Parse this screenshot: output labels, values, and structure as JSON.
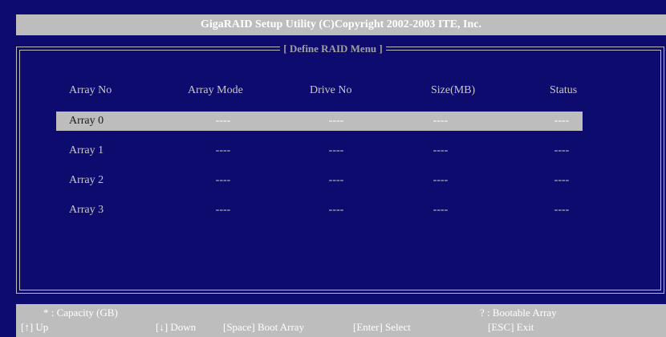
{
  "title": "GigaRAID Setup Utility (C)Copyright 2002-2003 ITE, Inc.",
  "menu_title": "[  Define RAID Menu  ]",
  "columns": [
    "Array No",
    "Array Mode",
    "Drive No",
    "Size(MB)",
    "Status"
  ],
  "rows": [
    {
      "no": "Array 0",
      "mode": "----",
      "drive": "----",
      "size": "----",
      "status": "----",
      "selected": true
    },
    {
      "no": "Array 1",
      "mode": "----",
      "drive": "----",
      "size": "----",
      "status": "----",
      "selected": false
    },
    {
      "no": "Array 2",
      "mode": "----",
      "drive": "----",
      "size": "----",
      "status": "----",
      "selected": false
    },
    {
      "no": "Array 3",
      "mode": "----",
      "drive": "----",
      "size": "----",
      "status": "----",
      "selected": false
    }
  ],
  "footer": {
    "legend_capacity": "* : Capacity (GB)",
    "legend_bootable": "?    : Bootable Array",
    "keys": {
      "up": "[↑] Up",
      "down": "[↓]  Down",
      "space": "[Space] Boot Array",
      "enter": "[Enter] Select",
      "esc": "[ESC] Exit"
    }
  },
  "colors": {
    "background": "#0d0b6e",
    "bar": "#bdbdbd",
    "text": "#c8c8c8"
  }
}
